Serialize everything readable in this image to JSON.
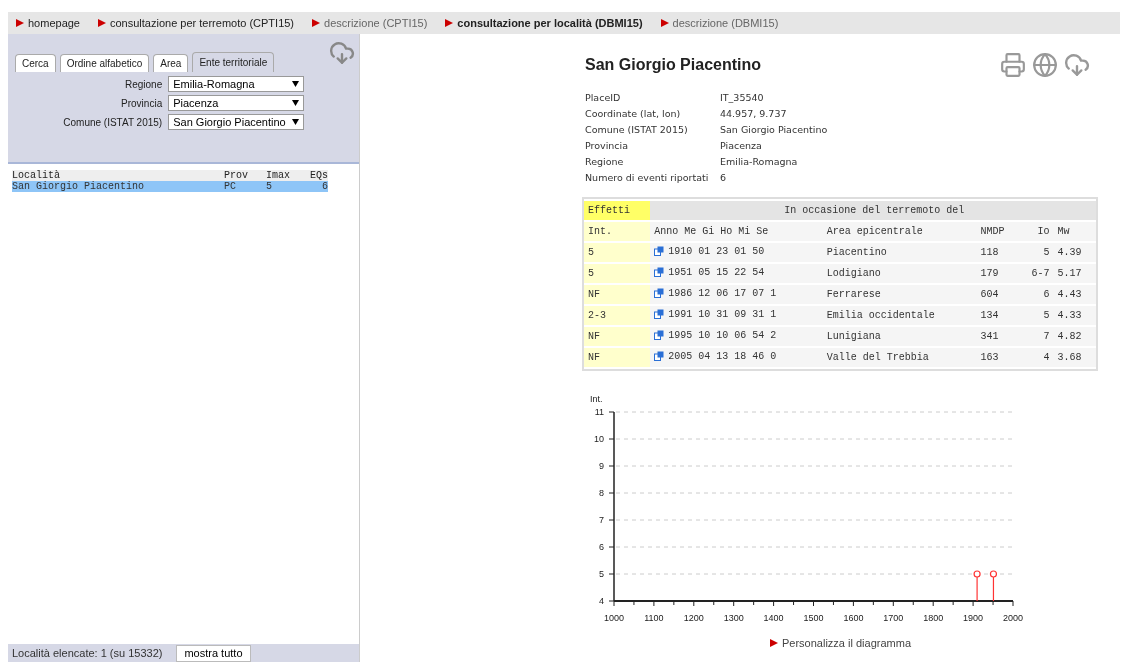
{
  "nav": [
    {
      "label": "homepage",
      "selected": false,
      "dim": false
    },
    {
      "label": "consultazione per terremoto (CPTI15)",
      "selected": false,
      "dim": false
    },
    {
      "label": "descrizione (CPTI15)",
      "selected": false,
      "dim": true
    },
    {
      "label": "consultazione per località (DBMI15)",
      "selected": true,
      "dim": false
    },
    {
      "label": "descrizione (DBMI15)",
      "selected": false,
      "dim": true
    }
  ],
  "sidebar": {
    "tabs": [
      {
        "label": "Cerca",
        "selected": false
      },
      {
        "label": "Ordine alfabetico",
        "selected": false
      },
      {
        "label": "Area",
        "selected": false
      },
      {
        "label": "Ente territoriale",
        "selected": true
      }
    ],
    "filters": [
      {
        "label": "Regione",
        "value": "Emilia-Romagna"
      },
      {
        "label": "Provincia",
        "value": "Piacenza"
      },
      {
        "label": "Comune (ISTAT 2015)",
        "value": "San Giorgio Piacentino"
      }
    ],
    "list": {
      "columns": [
        "Località",
        "Prov",
        "Imax",
        "EQs"
      ],
      "rows": [
        {
          "cells": [
            "San Giorgio Piacentino",
            "PC",
            "5",
            "6"
          ],
          "selected": true
        }
      ]
    },
    "footer": {
      "text": "Località elencate: 1 (su 15332)",
      "button": "mostra tutto"
    }
  },
  "place": {
    "title": "San Giorgio Piacentino",
    "details": [
      {
        "label": "PlaceID",
        "value": "IT_35540"
      },
      {
        "label": "Coordinate (lat, lon)",
        "value": "44.957, 9.737"
      },
      {
        "label": "Comune (ISTAT 2015)",
        "value": "San Giorgio Piacentino"
      },
      {
        "label": "Provincia",
        "value": "Piacenza"
      },
      {
        "label": "Regione",
        "value": "Emilia-Romagna"
      },
      {
        "label": "Numero di eventi riportati",
        "value": "6"
      }
    ]
  },
  "table": {
    "group_headers": [
      "Effetti",
      "In occasione del terremoto del"
    ],
    "columns": [
      "Int.",
      "Anno Me Gi Ho Mi Se",
      "Area epicentrale",
      "NMDP",
      "Io",
      "Mw"
    ],
    "rows": [
      {
        "int": "5",
        "date": "1910 01 23 01 50",
        "area": "Piacentino",
        "nmdp": "118",
        "io": "5",
        "mw": "4.39"
      },
      {
        "int": "5",
        "date": "1951 05 15 22 54",
        "area": "Lodigiano",
        "nmdp": "179",
        "io": "6-7",
        "mw": "5.17"
      },
      {
        "int": "NF",
        "date": "1986 12 06 17 07 1",
        "area": "Ferrarese",
        "nmdp": "604",
        "io": "6",
        "mw": "4.43"
      },
      {
        "int": "2-3",
        "date": "1991 10 31 09 31 1",
        "area": "Emilia occidentale",
        "nmdp": "134",
        "io": "5",
        "mw": "4.33"
      },
      {
        "int": "NF",
        "date": "1995 10 10 06 54 2",
        "area": "Lunigiana",
        "nmdp": "341",
        "io": "7",
        "mw": "4.82"
      },
      {
        "int": "NF",
        "date": "2005 04 13 18 46 0",
        "area": "Valle del Trebbia",
        "nmdp": "163",
        "io": "4",
        "mw": "3.68"
      }
    ]
  },
  "chart": {
    "chart_data": {
      "type": "scatter",
      "ylabel": "Int.",
      "x": [
        1910,
        1951
      ],
      "series": [
        {
          "color": "#ff3333",
          "values": [
            5,
            5
          ]
        }
      ],
      "grid": true,
      "xlim": [
        1000,
        2000
      ],
      "ylim": [
        4,
        11
      ],
      "xticks": [
        1000,
        1100,
        1200,
        1300,
        1400,
        1500,
        1600,
        1700,
        1800,
        1900,
        2000
      ],
      "yticks": [
        4,
        5,
        6,
        7,
        8,
        9,
        10,
        11
      ]
    },
    "link": "Personalizza il diagramma"
  }
}
